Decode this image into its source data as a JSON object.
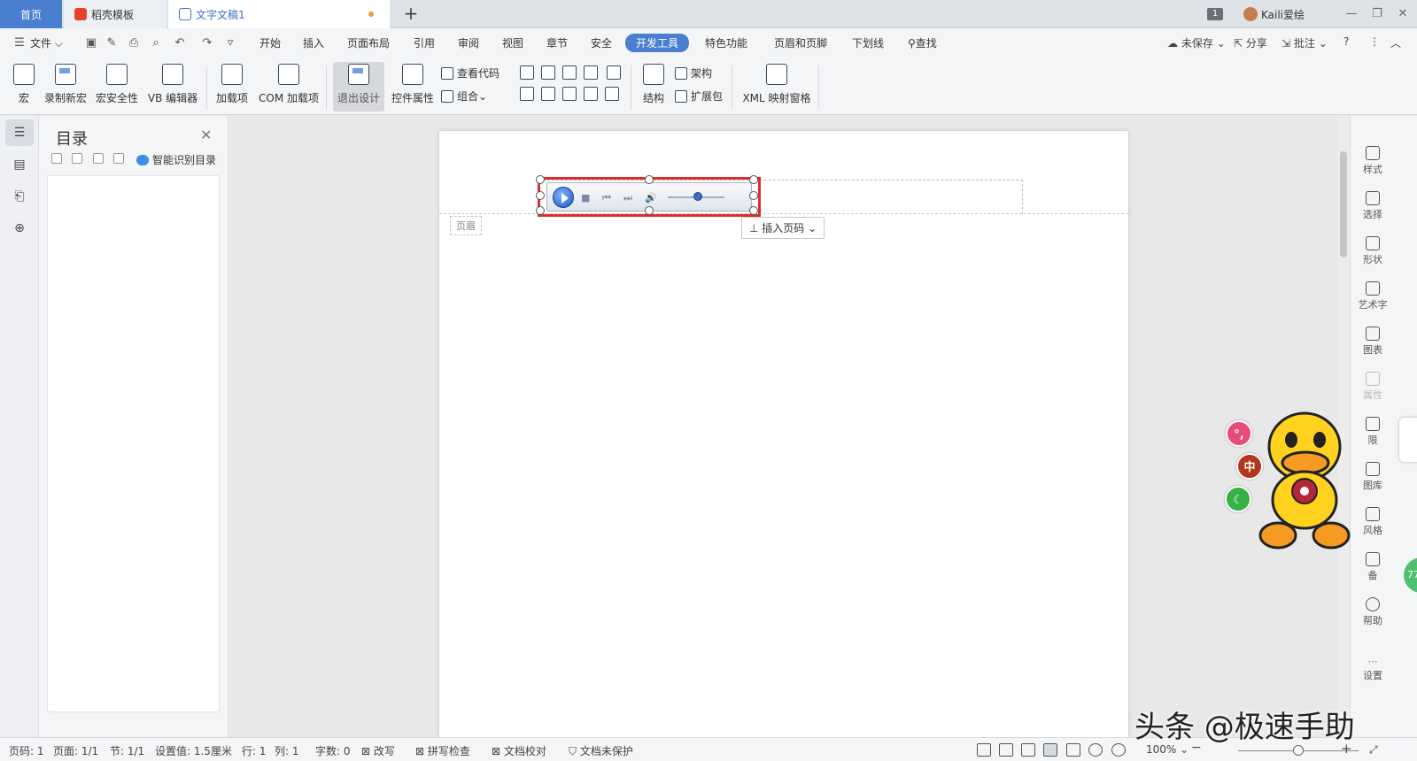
{
  "tabs": {
    "home": "首页",
    "template": "稻壳模板",
    "doc": "文字文稿1",
    "new_tab": "+"
  },
  "titlebar_right": {
    "badge": "1",
    "user": "Kaili爱绘"
  },
  "menu": {
    "file": "文件",
    "items": [
      "开始",
      "插入",
      "页面布局",
      "引用",
      "审阅",
      "视图",
      "章节",
      "安全",
      "开发工具",
      "特色功能",
      "页眉和页脚",
      "下划线"
    ],
    "active": "开发工具",
    "search": "查找",
    "right": [
      "未保存",
      "分享",
      "批注"
    ]
  },
  "ribbon": {
    "macro": "宏",
    "record": "录制新宏",
    "security": "宏安全性",
    "vb": "VB 编辑器",
    "addins": "加载项",
    "com": "COM 加载项",
    "exit_design": "退出设计",
    "control_props": "控件属性",
    "view_code": "查看代码",
    "group": "组合",
    "structure": "结构",
    "schema": "架构",
    "expansion": "扩展包",
    "xml": "XML 映射窗格"
  },
  "toc": {
    "title": "目录",
    "smart": "智能识别目录"
  },
  "document": {
    "header_tag": "页眉",
    "insert_page_number": "插入页码"
  },
  "right_panel": {
    "items": [
      "样式",
      "选择",
      "形状",
      "艺术字",
      "图表",
      "属性",
      "限",
      "图库",
      "风格",
      "备",
      "帮助",
      "设置"
    ]
  },
  "floating": {
    "zh": "中",
    "comma": "°,",
    "green_badge": "77"
  },
  "status": {
    "page": "页码: 1",
    "pages": "页面: 1/1",
    "section": "节: 1/1",
    "setting": "设置值: 1.5厘米",
    "row": "行: 1",
    "col": "列: 1",
    "words": "字数: 0",
    "revise": "改写",
    "spell": "拼写检查",
    "proof": "文档校对",
    "protect": "文档未保护",
    "zoom": "100%"
  },
  "watermark": "头条 @极速手助"
}
